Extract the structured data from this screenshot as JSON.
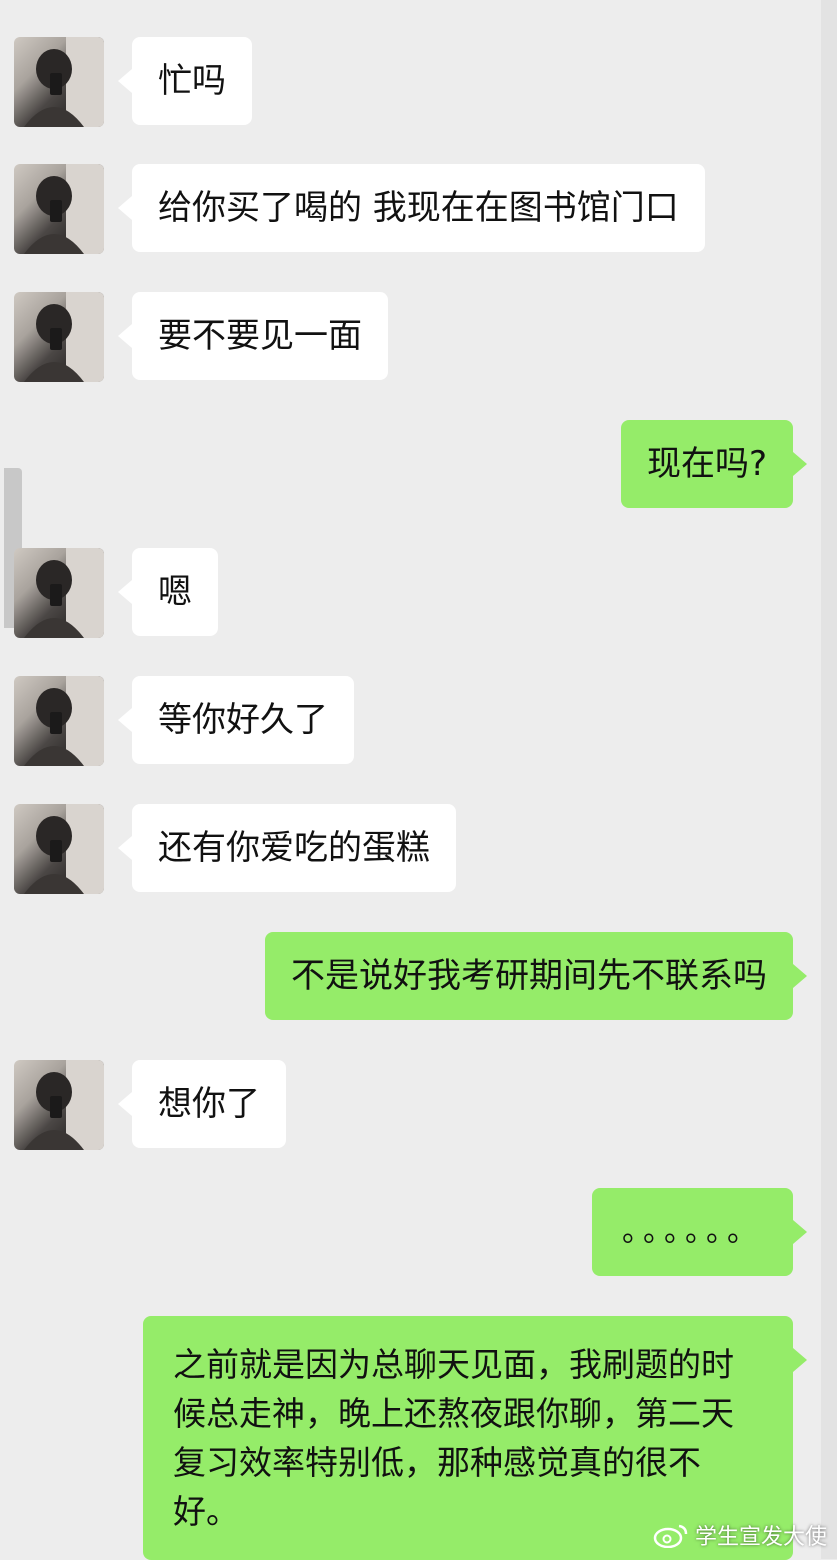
{
  "messages": [
    {
      "side": "left",
      "text": "忙吗"
    },
    {
      "side": "left",
      "text": "给你买了喝的 我现在在图书馆门口"
    },
    {
      "side": "left",
      "text": "要不要见一面"
    },
    {
      "side": "right",
      "text": "现在吗?"
    },
    {
      "side": "left",
      "text": "嗯"
    },
    {
      "side": "left",
      "text": "等你好久了"
    },
    {
      "side": "left",
      "text": "还有你爱吃的蛋糕"
    },
    {
      "side": "right",
      "text": "不是说好我考研期间先不联系吗"
    },
    {
      "side": "left",
      "text": "想你了"
    },
    {
      "side": "right",
      "text": "。。。。。。"
    },
    {
      "side": "right",
      "text": "之前就是因为总聊天见面，我刷题的时候总走神，晚上还熬夜跟你聊，第二天复习效率特别低，那种感觉真的很不好。"
    }
  ],
  "watermark": {
    "text": "学生宣发大使",
    "icon": "weibo-icon"
  },
  "colors": {
    "background": "#ededed",
    "incoming_bubble": "#ffffff",
    "outgoing_bubble": "#95ec69"
  }
}
